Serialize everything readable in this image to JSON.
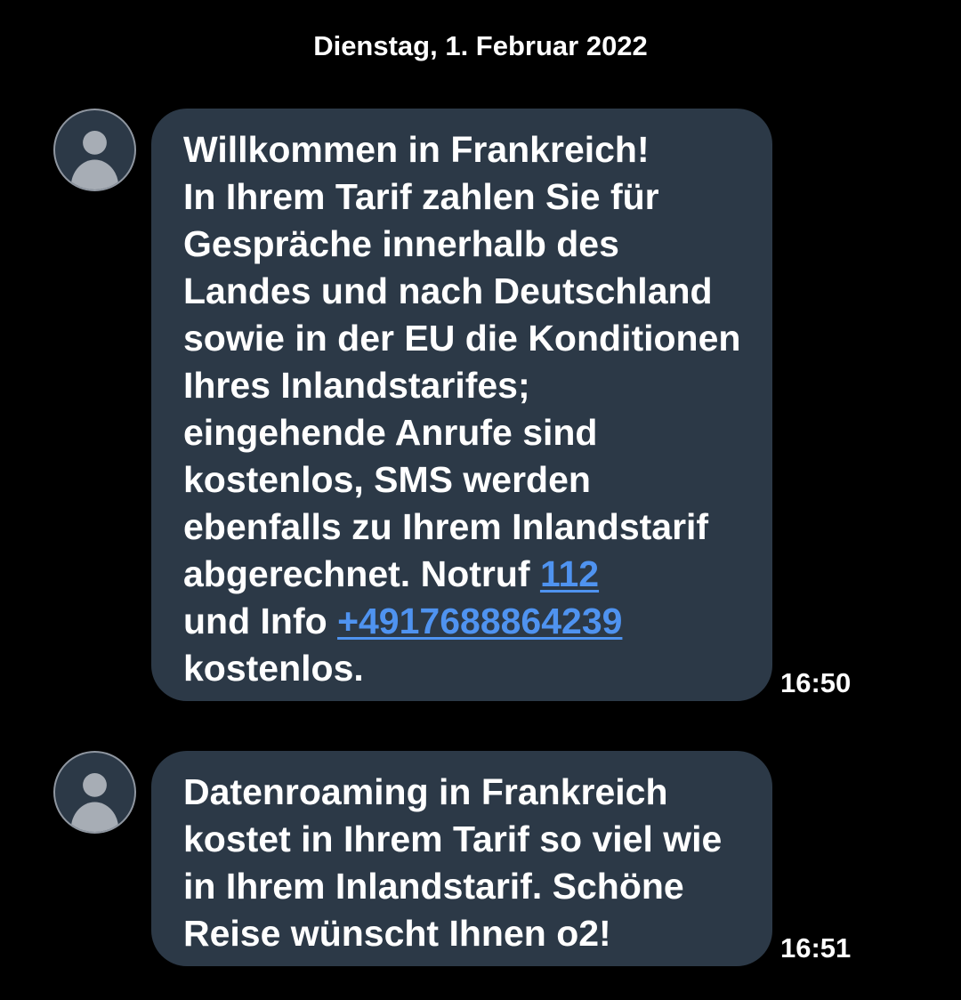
{
  "date_header": "Dienstag, 1. Februar 2022",
  "colors": {
    "background": "#000000",
    "bubble": "#2c3947",
    "link": "#4f93f0",
    "text": "#ffffff"
  },
  "messages": [
    {
      "avatar_icon": "person-icon",
      "lines": {
        "l0": "Willkommen in Frankreich!",
        "l1": "In Ihrem Tarif zahlen Sie für",
        "l2": "Gespräche innerhalb des",
        "l3": "Landes und nach Deutschland",
        "l4": "sowie in der EU die Konditionen",
        "l5": "Ihres Inlandstarifes;",
        "l6": "eingehende Anrufe sind",
        "l7": "kostenlos, SMS werden",
        "l8": "ebenfalls zu Ihrem Inlandstarif",
        "l9": "abgerechnet. Notruf ",
        "l10": "und Info ",
        "l11": "kostenlos."
      },
      "links": {
        "emergency": "112",
        "info": "+4917688864239"
      },
      "time": "16:50"
    },
    {
      "avatar_icon": "person-icon",
      "lines": {
        "l0": "Datenroaming in Frankreich",
        "l1": "kostet in Ihrem Tarif so viel wie",
        "l2": "in Ihrem Inlandstarif. Schöne",
        "l3": "Reise wünscht Ihnen o2!"
      },
      "time": "16:51"
    }
  ]
}
